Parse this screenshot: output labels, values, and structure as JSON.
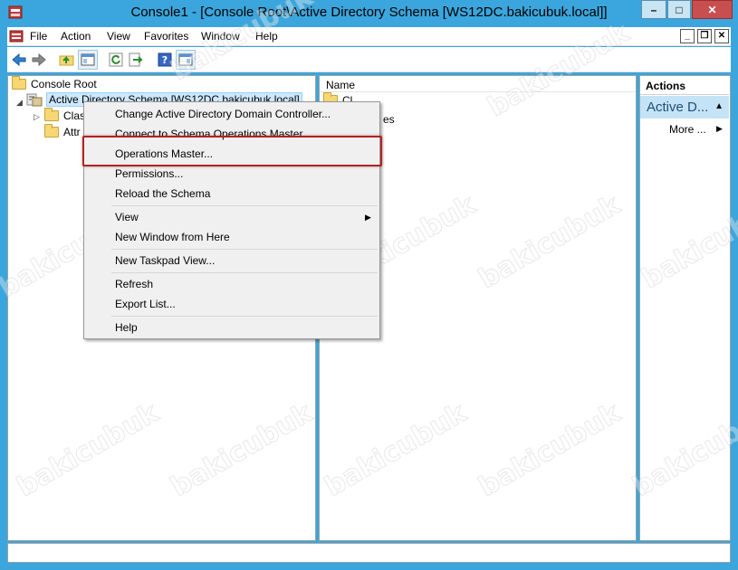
{
  "window": {
    "title": "Console1 - [Console Root\\Active Directory Schema [WS12DC.bakicubuk.local]]",
    "minimize": "–",
    "maximize": "□",
    "close": "✕"
  },
  "menubar": {
    "items": [
      "File",
      "Action",
      "View",
      "Favorites",
      "Window",
      "Help"
    ],
    "mdi_minimize": "_",
    "mdi_restore": "❐",
    "mdi_close": "✕"
  },
  "toolbar": {
    "buttons": [
      "back-arrow-icon",
      "forward-arrow-icon",
      "up-folder-icon",
      "show-hide-console-tree-icon",
      "refresh-icon",
      "export-list-icon",
      "help-icon",
      "show-hide-action-pane-icon"
    ]
  },
  "tree": {
    "root": "Console Root",
    "schema_node": "Active Directory Schema [WS12DC.bakicubuk.local]",
    "children": [
      "Clas",
      "Attr"
    ]
  },
  "list": {
    "column_name": "Name",
    "rows": [
      "Cl",
      "es"
    ]
  },
  "actions": {
    "header": "Actions",
    "group": "Active D...",
    "more": "More ..."
  },
  "context_menu": {
    "items": [
      "Change Active Directory Domain Controller...",
      "Connect to Schema Operations Master",
      "Operations Master...",
      "Permissions...",
      "Reload the Schema",
      "View",
      "New Window from Here",
      "New Taskpad View...",
      "Refresh",
      "Export List...",
      "Help"
    ],
    "view_arrow": "▶"
  },
  "watermark": "bakicubuk",
  "colors": {
    "frame": "#3aa6dd",
    "highlight_box": "#b22222",
    "selection": "#cde8ff",
    "actions_group": "#c5e3f6"
  }
}
